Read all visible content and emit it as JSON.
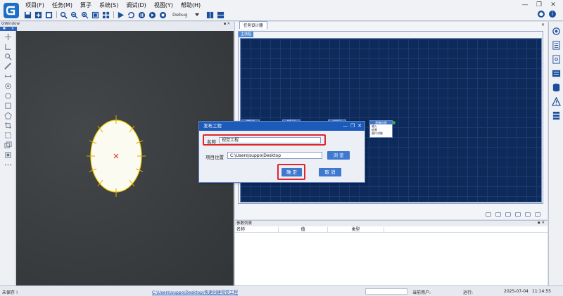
{
  "menu": [
    {
      "label": "项目(F)"
    },
    {
      "label": "任务(M)"
    },
    {
      "label": "算子"
    },
    {
      "label": "系统(S)"
    },
    {
      "label": "调试(D)"
    },
    {
      "label": "视图(Y)"
    },
    {
      "label": "帮助(H)"
    }
  ],
  "toolbar": {
    "mode": "Debug"
  },
  "gwindow": {
    "title": "GWindow"
  },
  "task": {
    "tab": "任务设计器",
    "subtab": "主流程",
    "nodes": [
      "图像采集",
      "检测工具",
      "位置补正",
      "图像处理"
    ],
    "card_rows": [
      "输入",
      "结果",
      "图片对象",
      "图片对象"
    ]
  },
  "params": {
    "title": "参数列表",
    "columns": [
      "名称",
      "值",
      "类型"
    ]
  },
  "dialog": {
    "title": "发布工程",
    "name_label": "名称",
    "name_value": "视觉工程",
    "location_label": "项目位置",
    "location_value": "C:\\Users\\suppo\\Desktop",
    "browse_label": "浏 览",
    "ok_label": "确 定",
    "cancel_label": "取 消"
  },
  "status": {
    "save": "未保存 !",
    "path": "C:\\Users\\suppo\\Desktop\\快速创建视觉工程",
    "user": "当前用户:",
    "run": "运行:",
    "date": "2025-07-04",
    "time": "11:14:55"
  },
  "colors": {
    "accent": "#1c5bb9",
    "highlight": "#e0262a",
    "canvas": "#0e2a5a"
  }
}
